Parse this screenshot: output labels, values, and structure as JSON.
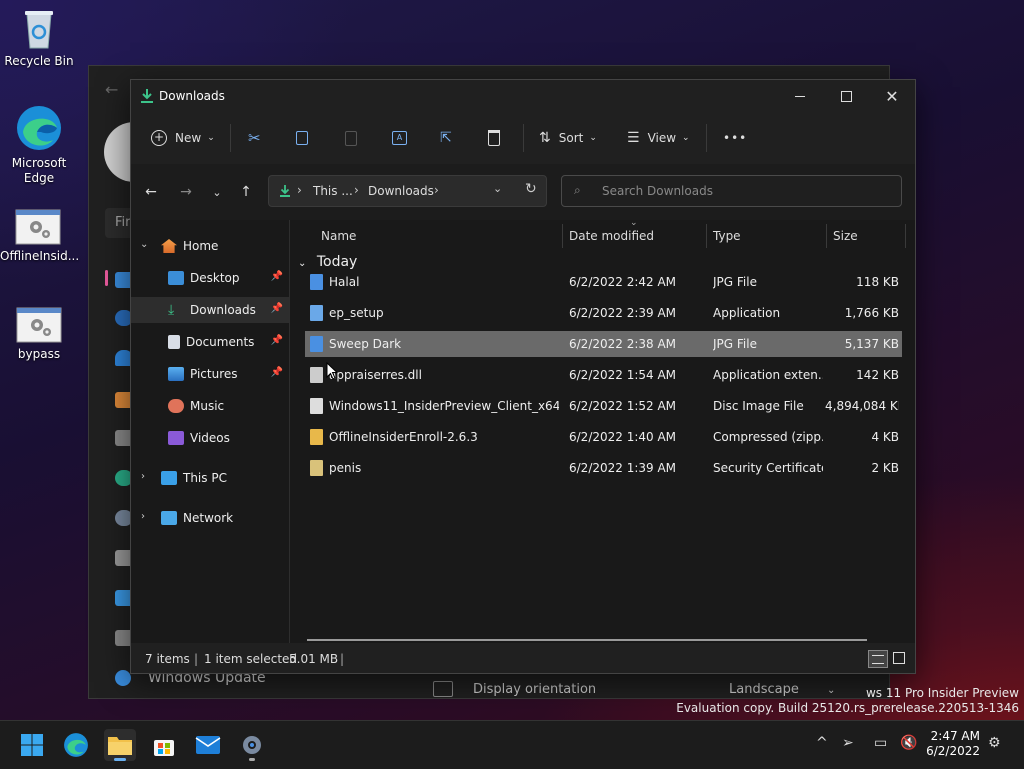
{
  "desktop": {
    "icons": [
      {
        "label": "Recycle Bin"
      },
      {
        "label": "Microsoft Edge"
      },
      {
        "label": "OfflineInsid..."
      },
      {
        "label": "bypass"
      }
    ]
  },
  "settings_window": {
    "search_placeholder": "Fir",
    "bottom_item": "Windows Update",
    "display_orientation_label": "Display orientation",
    "display_orientation_value": "Landscape"
  },
  "explorer": {
    "title": "Downloads",
    "toolbar": {
      "new_label": "New",
      "sort_label": "Sort",
      "view_label": "View",
      "more_label": "•••"
    },
    "address": {
      "crumb_1": "This ...",
      "crumb_2": "Downloads",
      "sep": "›"
    },
    "search_placeholder": "Search Downloads",
    "nav": {
      "home": "Home",
      "desktop": "Desktop",
      "downloads": "Downloads",
      "documents": "Documents",
      "pictures": "Pictures",
      "music": "Music",
      "videos": "Videos",
      "this_pc": "This PC",
      "network": "Network"
    },
    "columns": {
      "name": "Name",
      "date": "Date modified",
      "type": "Type",
      "size": "Size"
    },
    "group_label": "Today",
    "files": [
      {
        "name": "Halal",
        "date": "6/2/2022 2:42 AM",
        "type": "JPG File",
        "size": "118 KB",
        "icon_color": "#4a90e2"
      },
      {
        "name": "ep_setup",
        "date": "6/2/2022 2:39 AM",
        "type": "Application",
        "size": "1,766 KB",
        "icon_color": "#6aa8e8"
      },
      {
        "name": "Sweep Dark",
        "date": "6/2/2022 2:38 AM",
        "type": "JPG File",
        "size": "5,137 KB",
        "icon_color": "#4a90e2"
      },
      {
        "name": "appraiserres.dll",
        "date": "6/2/2022 1:54 AM",
        "type": "Application exten...",
        "size": "142 KB",
        "icon_color": "#cccccc"
      },
      {
        "name": "Windows11_InsiderPreview_Client_x64_e...",
        "date": "6/2/2022 1:52 AM",
        "type": "Disc Image File",
        "size": "4,894,084 KB",
        "icon_color": "#dddddd"
      },
      {
        "name": "OfflineInsiderEnroll-2.6.3",
        "date": "6/2/2022 1:40 AM",
        "type": "Compressed (zipp...",
        "size": "4 KB",
        "icon_color": "#e8b84a"
      },
      {
        "name": "penis",
        "date": "6/2/2022 1:39 AM",
        "type": "Security Certificate",
        "size": "2 KB",
        "icon_color": "#d9c27a"
      }
    ],
    "status": {
      "items": "7 items",
      "selected": "1 item selected",
      "size": "5.01 MB"
    }
  },
  "watermark": {
    "line1": "ws 11 Pro Insider Preview",
    "line2": "Evaluation copy. Build 25120.rs_prerelease.220513-1346"
  },
  "taskbar": {
    "time": "2:47 AM",
    "date": "6/2/2022"
  }
}
